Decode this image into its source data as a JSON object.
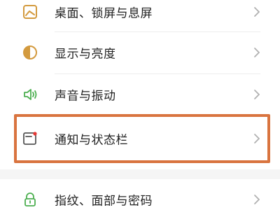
{
  "settings": {
    "items": [
      {
        "label": "桌面、锁屏与息屏",
        "icon": "wallpaper-icon"
      },
      {
        "label": "显示与亮度",
        "icon": "brightness-icon"
      },
      {
        "label": "声音与振动",
        "icon": "speaker-icon"
      },
      {
        "label": "通知与状态栏",
        "icon": "notification-icon",
        "highlighted": true
      },
      {
        "label": "指纹、面部与密码",
        "icon": "lock-icon"
      }
    ]
  },
  "colors": {
    "accent_icon": "#d39a3e",
    "highlight_border": "#d9743f",
    "chevron": "#b0b0b0"
  }
}
